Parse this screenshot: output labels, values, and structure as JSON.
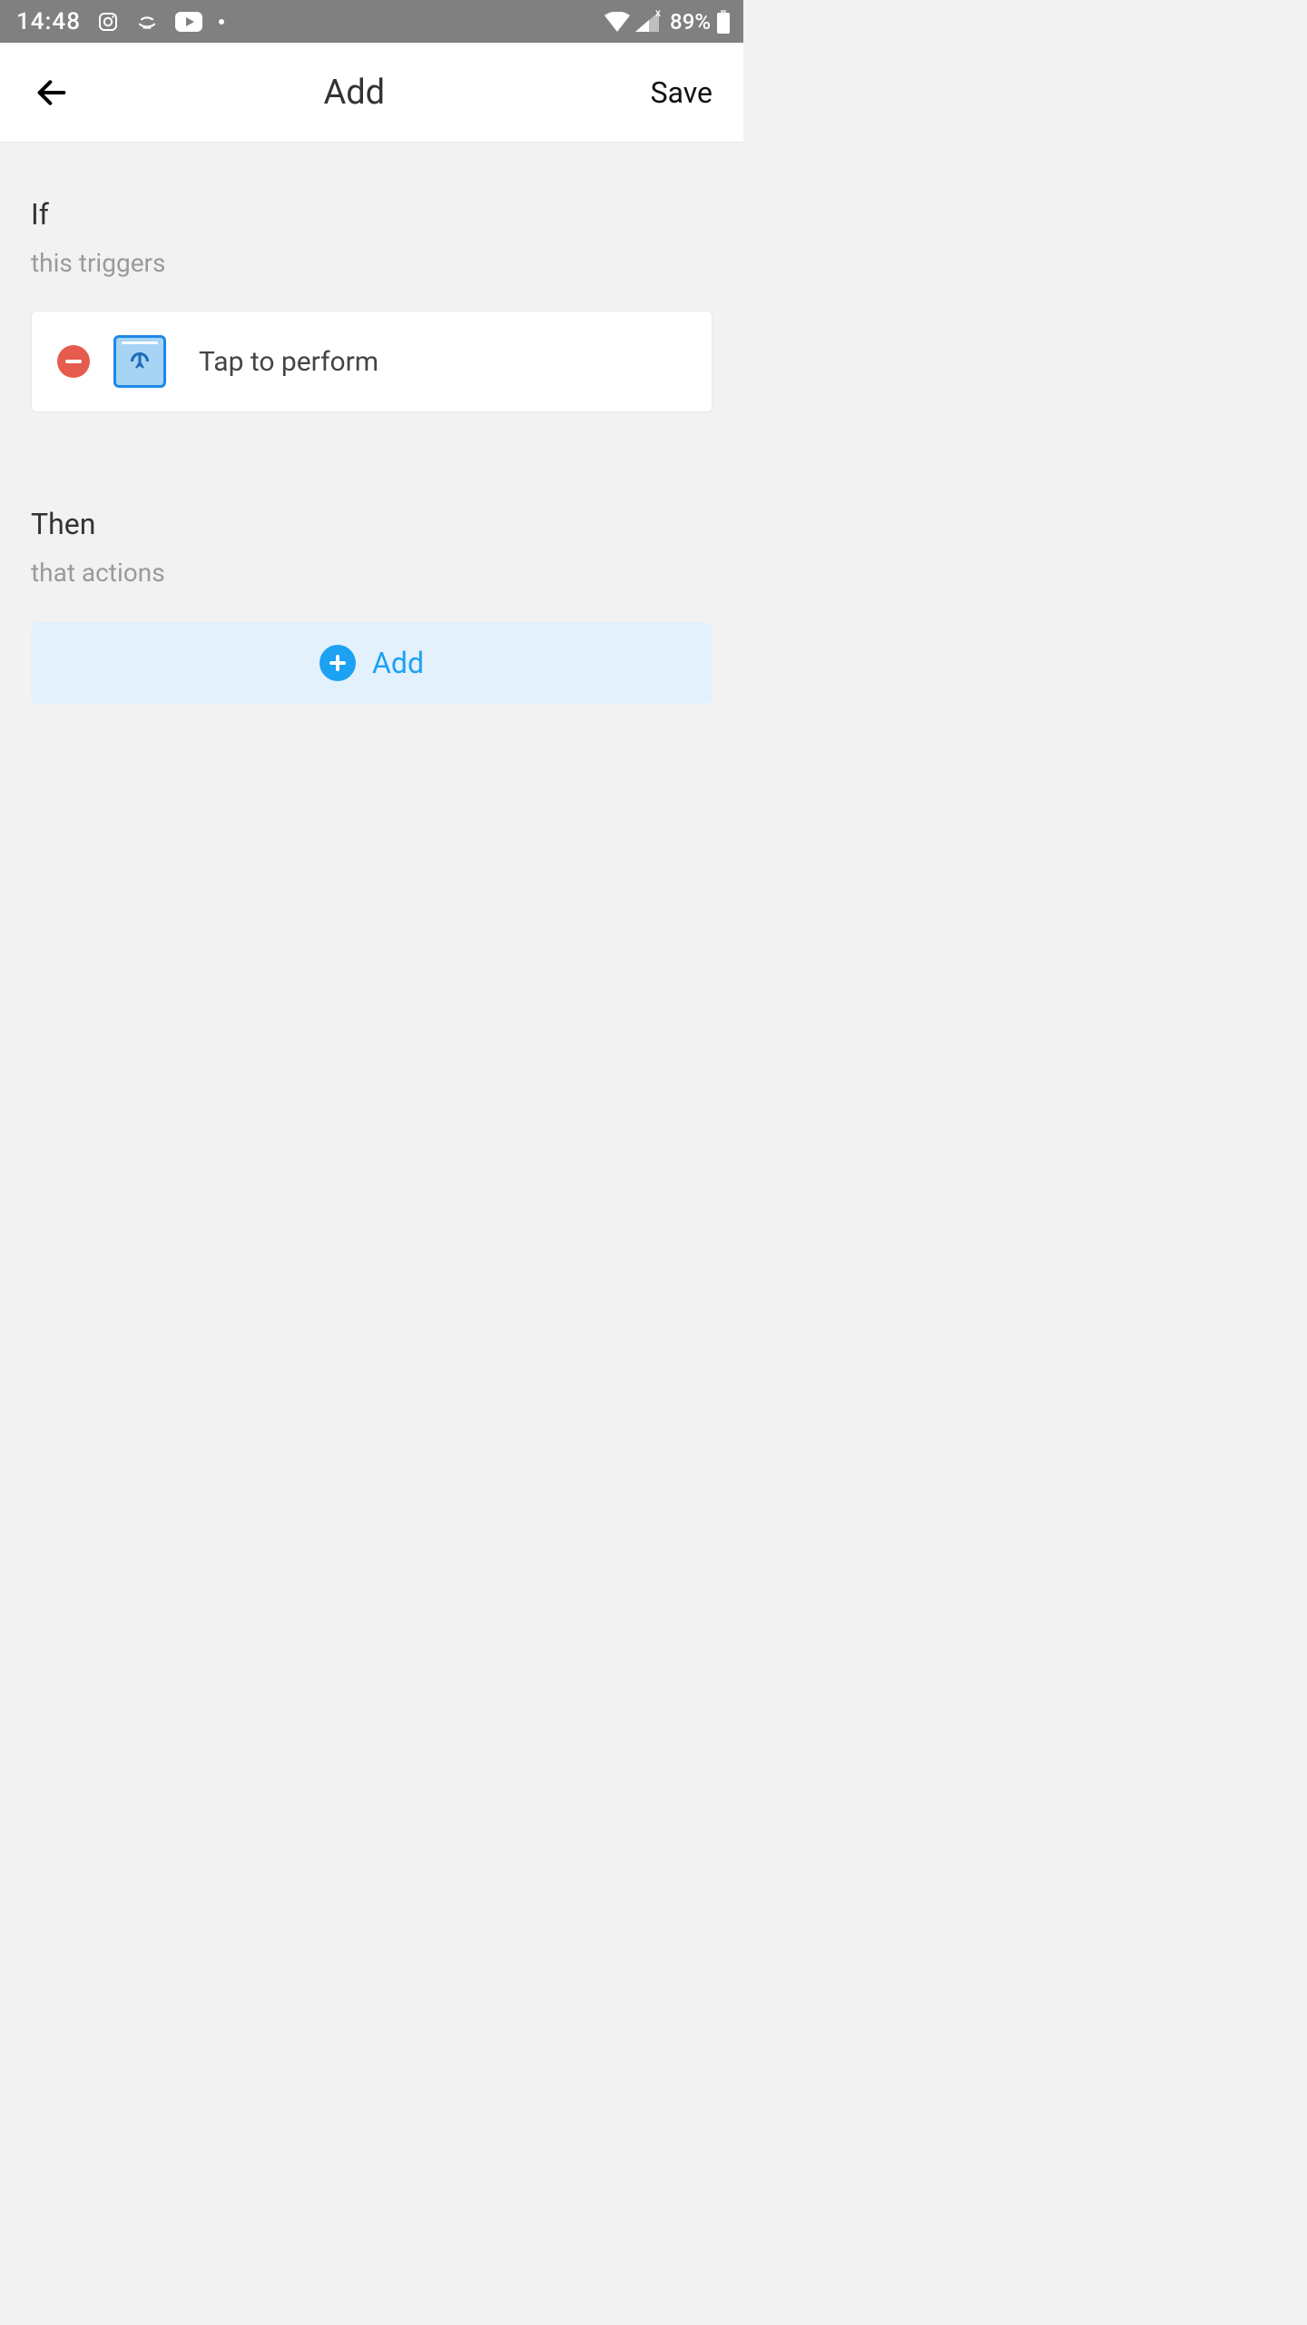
{
  "status": {
    "time": "14:48",
    "battery": "89%"
  },
  "header": {
    "title": "Add",
    "save_label": "Save"
  },
  "if_section": {
    "title": "If",
    "subtitle": "this triggers",
    "trigger_label": "Tap to perform"
  },
  "then_section": {
    "title": "Then",
    "subtitle": "that actions",
    "add_label": "Add"
  }
}
